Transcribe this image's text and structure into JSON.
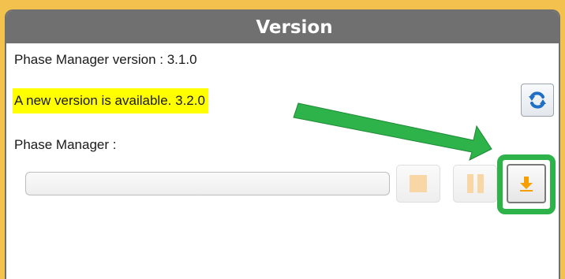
{
  "window": {
    "title": "Version"
  },
  "info": {
    "current_version_label": "Phase Manager version :  3.1.0",
    "update_notice": "A new version is available. 3.2.0",
    "component_label": "Phase Manager :"
  },
  "progress": {
    "value": 0
  },
  "buttons": {
    "refresh_icon": "refresh-icon",
    "stop_icon": "stop-icon",
    "pause_icon": "pause-icon",
    "download_icon": "download-icon"
  },
  "colors": {
    "title_bar": "#707070",
    "frame": "#f2c14e",
    "highlight": "#ffff00",
    "annotation": "#2db34a",
    "refresh_icon": "#1f6fc4",
    "download_icon": "#f5a000",
    "disabled_icon": "#f9d6a6"
  }
}
